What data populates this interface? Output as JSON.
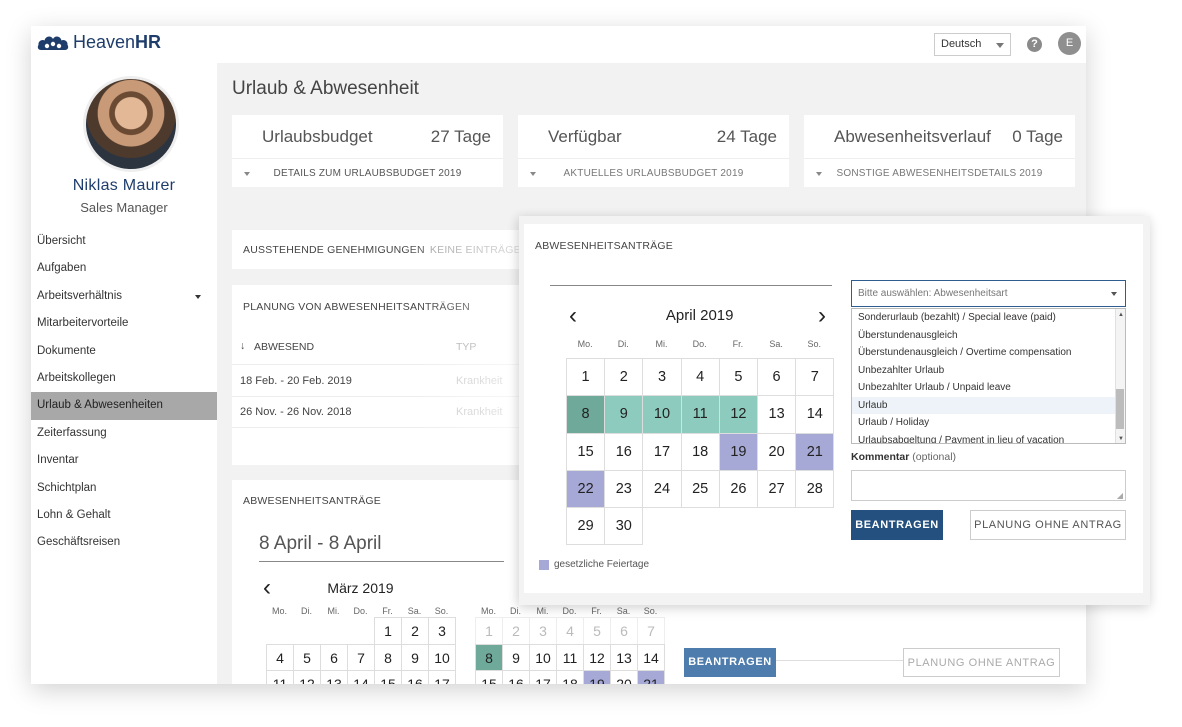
{
  "app": {
    "logo_text_light": "Heaven",
    "logo_text_bold": "HR",
    "language": "Deutsch",
    "help": "?",
    "user_initial": "E"
  },
  "profile": {
    "name": "Niklas Maurer",
    "role": "Sales Manager"
  },
  "nav": [
    {
      "label": "Übersicht"
    },
    {
      "label": "Aufgaben"
    },
    {
      "label": "Arbeitsverhältnis",
      "dropdown": true
    },
    {
      "label": "Mitarbeitervorteile"
    },
    {
      "label": "Dokumente"
    },
    {
      "label": "Arbeitskollegen"
    },
    {
      "label": "Urlaub & Abwesenheiten",
      "active": true
    },
    {
      "label": "Zeiterfassung"
    },
    {
      "label": "Inventar"
    },
    {
      "label": "Schichtplan"
    },
    {
      "label": "Lohn & Gehalt"
    },
    {
      "label": "Geschäftsreisen"
    }
  ],
  "page": {
    "title": "Urlaub & Abwesenheit"
  },
  "budget_cards": [
    {
      "label": "Urlaubsbudget",
      "value": "27 Tage",
      "footer": "DETAILS ZUM URLAUBSBUDGET 2019"
    },
    {
      "label": "Verfügbar",
      "value": "24 Tage",
      "footer": "AKTUELLES URLAUBSBUDGET 2019"
    },
    {
      "label": "Abwesenheitsverlauf",
      "value": "0 Tage",
      "footer": "SONSTIGE ABWESENHEITSDETAILS 2019"
    }
  ],
  "pending": {
    "title": "AUSSTEHENDE GENEHMIGUNGEN",
    "empty": "KEINE EINTRÄGE"
  },
  "planning": {
    "title": "PLANUNG VON ABWESENHEITSANTRÄGEN",
    "col_absent": "ABWESEND",
    "col_type": "TYP",
    "rows": [
      {
        "dates": "18 Feb. - 20 Feb. 2019",
        "type": "Krankheit"
      },
      {
        "dates": "26 Nov. - 26 Nov. 2018",
        "type": "Krankheit"
      }
    ]
  },
  "requests_bg": {
    "title": "ABWESENHEITSANTRÄGE",
    "range": "8 April - 8 April",
    "month_title": "März 2019",
    "weekdays": [
      "Mo.",
      "Di.",
      "Mi.",
      "Do.",
      "Fr.",
      "Sa.",
      "So."
    ],
    "submit": "BEANTRAGEN",
    "plan_without": "PLANUNG OHNE ANTRAG"
  },
  "modal": {
    "title": "ABWESENHEITSANTRÄGE",
    "calendar_title": "April 2019",
    "weekdays": [
      "Mo.",
      "Di.",
      "Mi.",
      "Do.",
      "Fr.",
      "Sa.",
      "So."
    ],
    "select_placeholder": "Bitte auswählen: Abwesenheitsart",
    "options": [
      "Sonderurlaub (bezahlt) / Special leave (paid)",
      "Überstundenausgleich",
      "Überstundenausgleich / Overtime compensation",
      "Unbezahlter Urlaub",
      "Unbezahlter Urlaub / Unpaid leave",
      "Urlaub",
      "Urlaub / Holiday",
      "Urlaubsabgeltung / Payment in lieu of vacation"
    ],
    "selected_option_index": 5,
    "comment_label": "Kommentar",
    "comment_optional": "(optional)",
    "submit": "BEANTRAGEN",
    "plan_without": "PLANUNG OHNE ANTRAG",
    "legend": "gesetzliche Feiertage"
  },
  "colors": {
    "brand": "#1f3d6b",
    "primary_button": "#23507e",
    "selected_dark": "#6fa99a",
    "selected_light": "#8ccbbd",
    "holiday": "#a6a8d6"
  }
}
